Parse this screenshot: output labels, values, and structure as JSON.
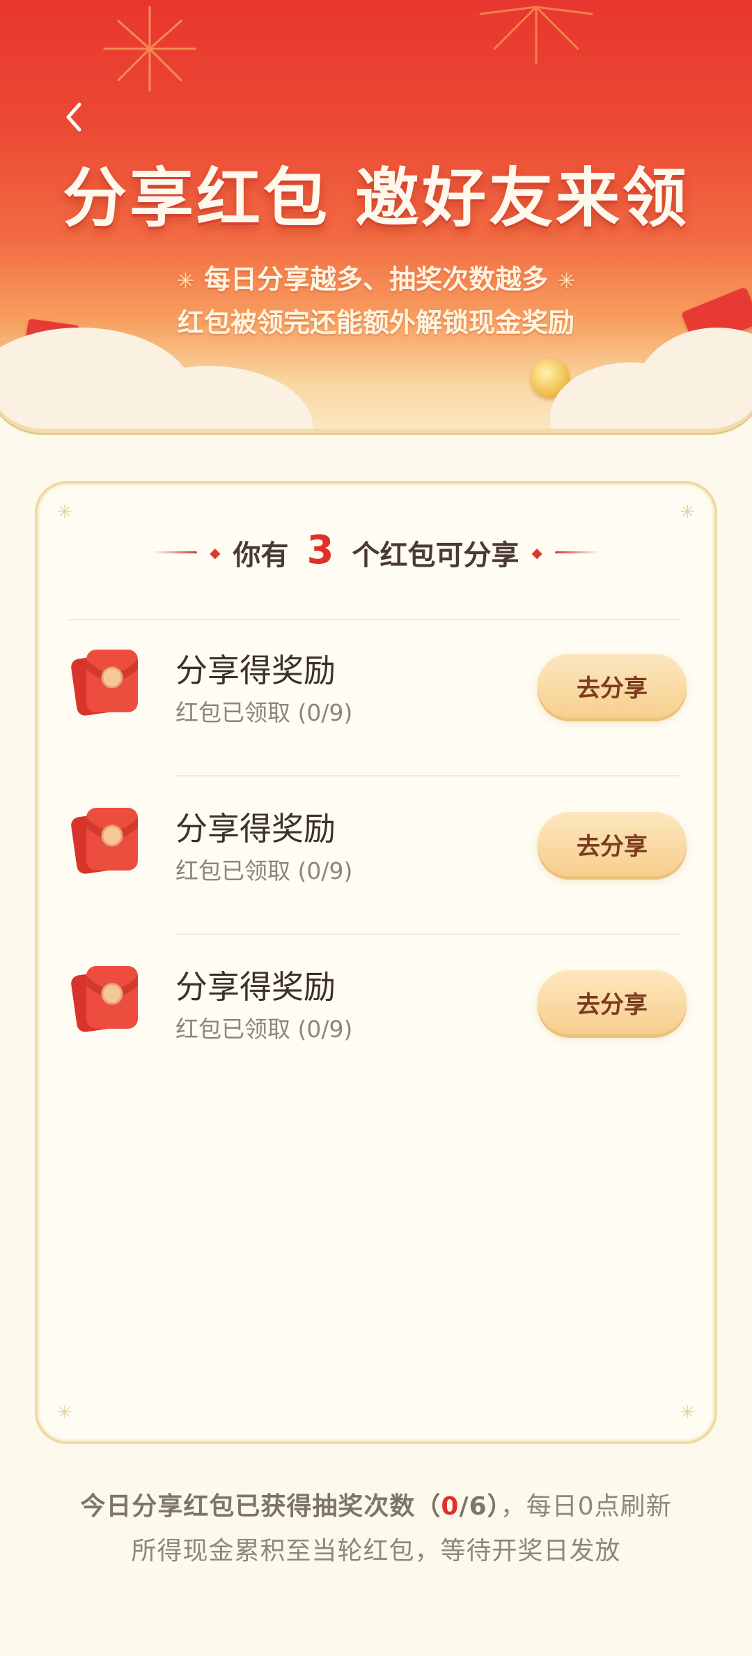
{
  "header": {
    "title": "分享红包 邀好友来领",
    "subtitle_line1": "每日分享越多、抽奖次数越多",
    "subtitle_line2": "红包被领完还能额外解锁现金奖励",
    "back_icon": "chevron-left-icon"
  },
  "card": {
    "title_prefix": "你有",
    "count": "3",
    "title_suffix": "个红包可分享",
    "items": [
      {
        "title": "分享得奖励",
        "progress": "红包已领取 (0/9)",
        "button": "去分享",
        "icon": "red-packet-icon"
      },
      {
        "title": "分享得奖励",
        "progress": "红包已领取 (0/9)",
        "button": "去分享",
        "icon": "red-packet-icon"
      },
      {
        "title": "分享得奖励",
        "progress": "红包已领取 (0/9)",
        "button": "去分享",
        "icon": "red-packet-icon"
      }
    ]
  },
  "footer": {
    "line1_strong": "今日分享红包已获得抽奖次数（",
    "line1_count": "0",
    "line1_total": "/6）",
    "line1_rest": "，每日0点刷新",
    "line2": "所得现金累积至当轮红包，等待开奖日发放"
  },
  "colors": {
    "accent_red": "#e02f27",
    "banner_red": "#e8362e",
    "button_gold": "#f6cf8d",
    "background": "#fdf9ed"
  }
}
